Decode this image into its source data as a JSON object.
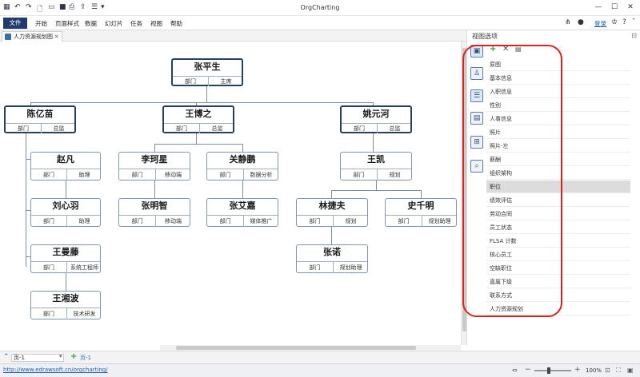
{
  "app": {
    "title": "OrgCharting"
  },
  "menu": {
    "file": "文件",
    "items": [
      "开始",
      "页面样式",
      "数据",
      "幻灯片",
      "任务",
      "视图",
      "帮助"
    ],
    "login": "登录"
  },
  "document_tab": {
    "label": "人力资源规划图"
  },
  "org_chart": {
    "nodes": [
      {
        "name": "张平生",
        "field1": "部门",
        "field2": "主席"
      },
      {
        "name": "陈亿苗",
        "field1": "部门",
        "field2": "总监"
      },
      {
        "name": "王博之",
        "field1": "部门",
        "field2": "总监"
      },
      {
        "name": "姚元河",
        "field1": "部门",
        "field2": "总监"
      },
      {
        "name": "赵凡",
        "field1": "部门",
        "field2": "助理"
      },
      {
        "name": "刘心羽",
        "field1": "部门",
        "field2": "助理"
      },
      {
        "name": "王曼藤",
        "field1": "部门",
        "field2": "系统工程师"
      },
      {
        "name": "王湘波",
        "field1": "部门",
        "field2": "技术研发"
      },
      {
        "name": "李珂星",
        "field1": "部门",
        "field2": "移动端"
      },
      {
        "name": "张明智",
        "field1": "部门",
        "field2": "移动端"
      },
      {
        "name": "关静鹏",
        "field1": "部门",
        "field2": "数据分析"
      },
      {
        "name": "张艾嘉",
        "field1": "部门",
        "field2": "媒体推广"
      },
      {
        "name": "王凯",
        "field1": "部门",
        "field2": "规划"
      },
      {
        "name": "林捷夫",
        "field1": "部门",
        "field2": "规划"
      },
      {
        "name": "史千明",
        "field1": "部门",
        "field2": "规划助理"
      },
      {
        "name": "张诺",
        "field1": "部门",
        "field2": "规划助理"
      }
    ]
  },
  "right_pane": {
    "title": "视图选项",
    "side_icons": [
      "contact-card-icon",
      "paint-bucket-icon",
      "list-view-icon",
      "calendar-icon",
      "tree-structure-icon",
      "search-list-icon"
    ],
    "fields": [
      "原图",
      "基本信息",
      "入职信息",
      "性别",
      "人事信息",
      "照片",
      "照片-左",
      "薪酬",
      "组织架构",
      "职位",
      "绩效评估",
      "劳动合同",
      "员工状态",
      "FLSA 计数",
      "核心员工",
      "空缺职位",
      "直属下级",
      "联系方式",
      "人力资源规划"
    ],
    "selected_index": 9
  },
  "page_bar": {
    "page_select": "页-1",
    "active_page": "页-1"
  },
  "status_bar": {
    "url": "http://www.edrawsoft.cn/orgcharting/",
    "zoom": "100%"
  },
  "colors": {
    "highlight_ring": "#e0201b",
    "file_menu_bg": "#1f3b6e",
    "node_border": "#7f96b4"
  }
}
